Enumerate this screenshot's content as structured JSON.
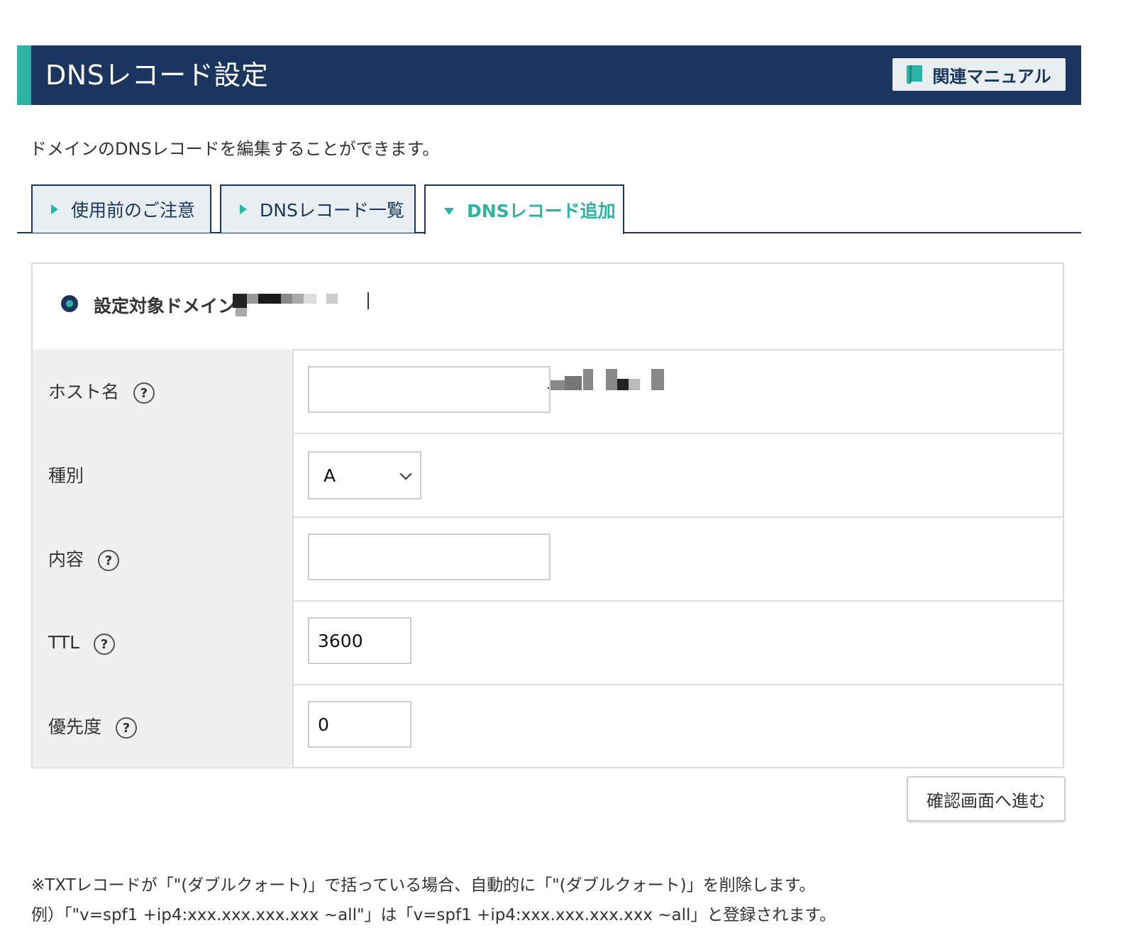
{
  "header": {
    "title": "DNSレコード設定",
    "manual_button": "関連マニュアル",
    "manual_icon": "book-icon"
  },
  "description": "ドメインのDNSレコードを編集することができます。",
  "tabs": [
    {
      "label": "使用前のご注意",
      "active": false
    },
    {
      "label": "DNSレコード一覧",
      "active": false
    },
    {
      "label": "DNSレコード追加",
      "active": true
    }
  ],
  "form": {
    "domain_label": "設定対象ドメイン",
    "rows": [
      {
        "label": "ホスト名",
        "has_help": true,
        "value": "",
        "placeholder": ""
      },
      {
        "label": "種別",
        "has_help": false,
        "selected": "A"
      },
      {
        "label": "内容",
        "has_help": true,
        "value": ""
      },
      {
        "label": "TTL",
        "has_help": true,
        "value": "3600"
      },
      {
        "label": "優先度",
        "has_help": true,
        "value": "0"
      }
    ],
    "help_glyph": "?"
  },
  "confirm_button": "確認画面へ進む",
  "notes": [
    "※TXTレコードが「\"(ダブルクォート)」で括っている場合、自動的に「\"(ダブルクォート)」を削除します。",
    "例）「\"v=spf1 +ip4:xxx.xxx.xxx.xxx ~all\"」は「v=spf1 +ip4:xxx.xxx.xxx.xxx ~all」と登録されます。"
  ],
  "colors": {
    "navy": "#1a3660",
    "teal": "#2bb3a3"
  }
}
